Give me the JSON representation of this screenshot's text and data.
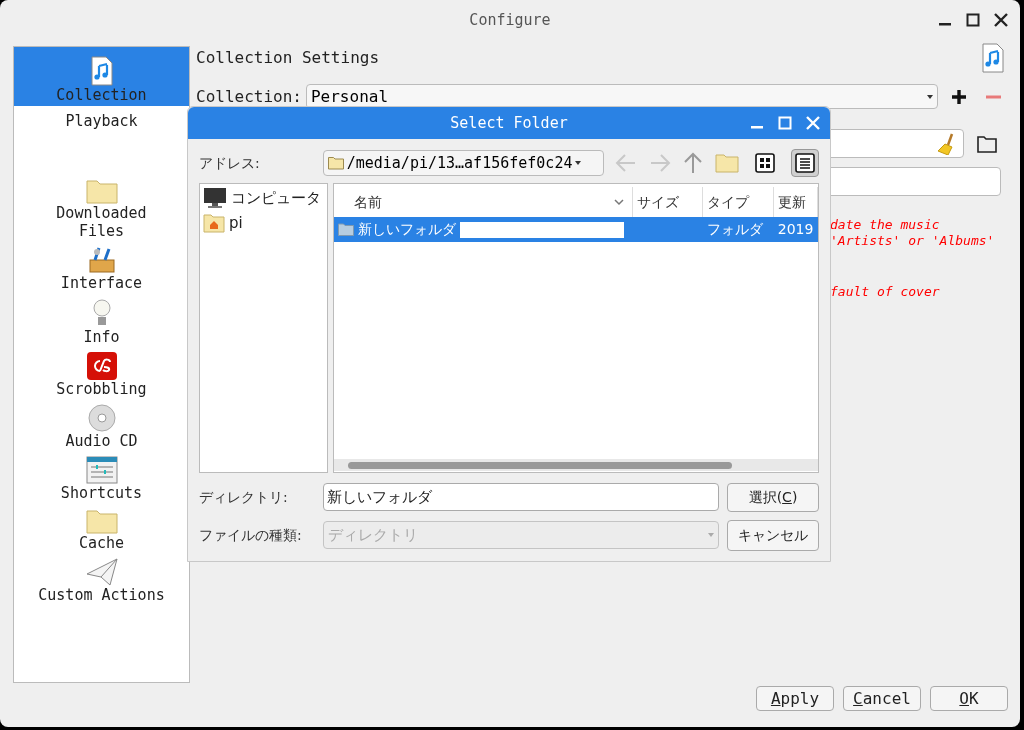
{
  "window": {
    "title": "Configure"
  },
  "sidebar": {
    "items": [
      {
        "label": "Collection",
        "kind": "music",
        "selected": true
      },
      {
        "label": "Playback",
        "kind": "plain",
        "selected": false
      },
      {
        "label": "Downloaded Files",
        "kind": "folder",
        "selected": false
      },
      {
        "label": "Interface",
        "kind": "tools",
        "selected": false
      },
      {
        "label": "Info",
        "kind": "bulb",
        "selected": false
      },
      {
        "label": "Scrobbling",
        "kind": "lastfm",
        "selected": false
      },
      {
        "label": "Audio CD",
        "kind": "disc",
        "selected": false
      },
      {
        "label": "Shortcuts",
        "kind": "sliders",
        "selected": false
      },
      {
        "label": "Cache",
        "kind": "folder",
        "selected": false
      },
      {
        "label": "Custom Actions",
        "kind": "plane",
        "selected": false
      }
    ]
  },
  "page": {
    "heading": "Collection Settings",
    "collection_label": "Collection:",
    "collection_value": "Personal",
    "hint_lines": [
      "date the music",
      "'Artists' or 'Albums'"
    ],
    "note_lines": [
      "fault of cover"
    ]
  },
  "buttons": [
    {
      "key": "A",
      "after": "pply"
    },
    {
      "key": "C",
      "after": "ancel"
    },
    {
      "key": "O",
      "after": "K"
    }
  ],
  "dialog": {
    "title": "Select Folder",
    "address_label": "アドレス:",
    "address_value": "/media/pi/13…af156fef0c24",
    "views": [
      {
        "kind": "icons",
        "selected": false
      },
      {
        "kind": "details",
        "selected": true
      }
    ],
    "places": [
      {
        "label": "コンピュータ",
        "kind": "computer"
      },
      {
        "label": "pi",
        "kind": "home"
      }
    ],
    "columns": [
      "名前",
      "サイズ",
      "タイプ",
      "更新"
    ],
    "rows": [
      {
        "name": "新しいフォルダ",
        "type": "フォルダ",
        "date": "2019",
        "selected": true
      }
    ],
    "directory_label": "ディレクトリ:",
    "directory_value": "新しいフォルダ",
    "filetype_label": "ファイルの種類:",
    "filetype_value": "ディレクトリ",
    "filetype_disabled": true,
    "choose_button": {
      "before": "選択(",
      "key": "C",
      "after": ")"
    },
    "cancel_button": {
      "before": "キャンセル"
    }
  }
}
